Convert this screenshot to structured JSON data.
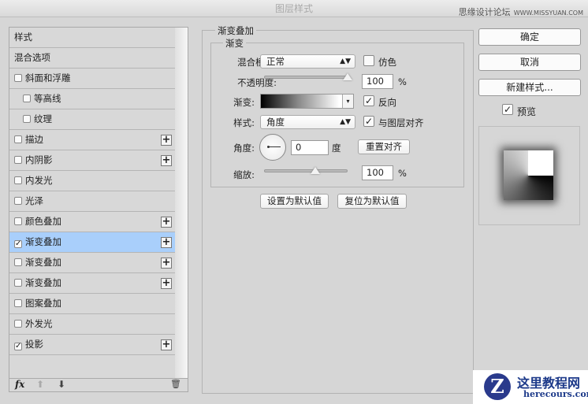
{
  "window": {
    "title": "图层样式",
    "watermark": "思缘设计论坛",
    "watermark_url": "WWW.MISSYUAN.COM"
  },
  "styles_list": [
    {
      "label": "样式",
      "checkbox": false,
      "plus": false
    },
    {
      "label": "混合选项",
      "checkbox": false,
      "plus": false
    },
    {
      "label": "斜面和浮雕",
      "checkbox": true,
      "checked": false,
      "plus": false
    },
    {
      "label": "等高线",
      "checkbox": true,
      "checked": false,
      "plus": false,
      "sub": true
    },
    {
      "label": "纹理",
      "checkbox": true,
      "checked": false,
      "plus": false,
      "sub": true
    },
    {
      "label": "描边",
      "checkbox": true,
      "checked": false,
      "plus": true
    },
    {
      "label": "内阴影",
      "checkbox": true,
      "checked": false,
      "plus": true
    },
    {
      "label": "内发光",
      "checkbox": true,
      "checked": false,
      "plus": false
    },
    {
      "label": "光泽",
      "checkbox": true,
      "checked": false,
      "plus": false
    },
    {
      "label": "颜色叠加",
      "checkbox": true,
      "checked": false,
      "plus": true
    },
    {
      "label": "渐变叠加",
      "checkbox": true,
      "checked": true,
      "plus": true,
      "selected": true
    },
    {
      "label": "渐变叠加",
      "checkbox": true,
      "checked": false,
      "plus": true
    },
    {
      "label": "渐变叠加",
      "checkbox": true,
      "checked": false,
      "plus": true
    },
    {
      "label": "图案叠加",
      "checkbox": true,
      "checked": false,
      "plus": false
    },
    {
      "label": "外发光",
      "checkbox": true,
      "checked": false,
      "plus": false
    },
    {
      "label": "投影",
      "checkbox": true,
      "checked": true,
      "plus": true
    }
  ],
  "toolbar": {
    "fx": "fx",
    "up": "⬆",
    "down": "⬇",
    "trash": "🗑"
  },
  "panel": {
    "title": "渐变叠加",
    "group": "渐变",
    "blend_mode_label": "混合模式:",
    "blend_mode": "正常",
    "dither_label": "仿色",
    "dither": false,
    "opacity_label": "不透明度:",
    "opacity": "100",
    "opacity_value": 100,
    "percent": "%",
    "gradient_label": "渐变:",
    "reverse_label": "反向",
    "reverse": true,
    "style_label": "样式:",
    "style": "角度",
    "align_label": "与图层对齐",
    "align": true,
    "angle_label": "角度:",
    "angle": "0",
    "degree": "度",
    "reset_align": "重置对齐",
    "scale_label": "缩放:",
    "scale": "100",
    "scale_value": 100,
    "make_default": "设置为默认值",
    "reset_default": "复位为默认值"
  },
  "buttons": {
    "ok": "确定",
    "cancel": "取消",
    "new_style": "新建样式...",
    "preview_label": "预览",
    "preview": true
  },
  "logo": {
    "name": "这里教程网",
    "url": "herecours.com"
  }
}
